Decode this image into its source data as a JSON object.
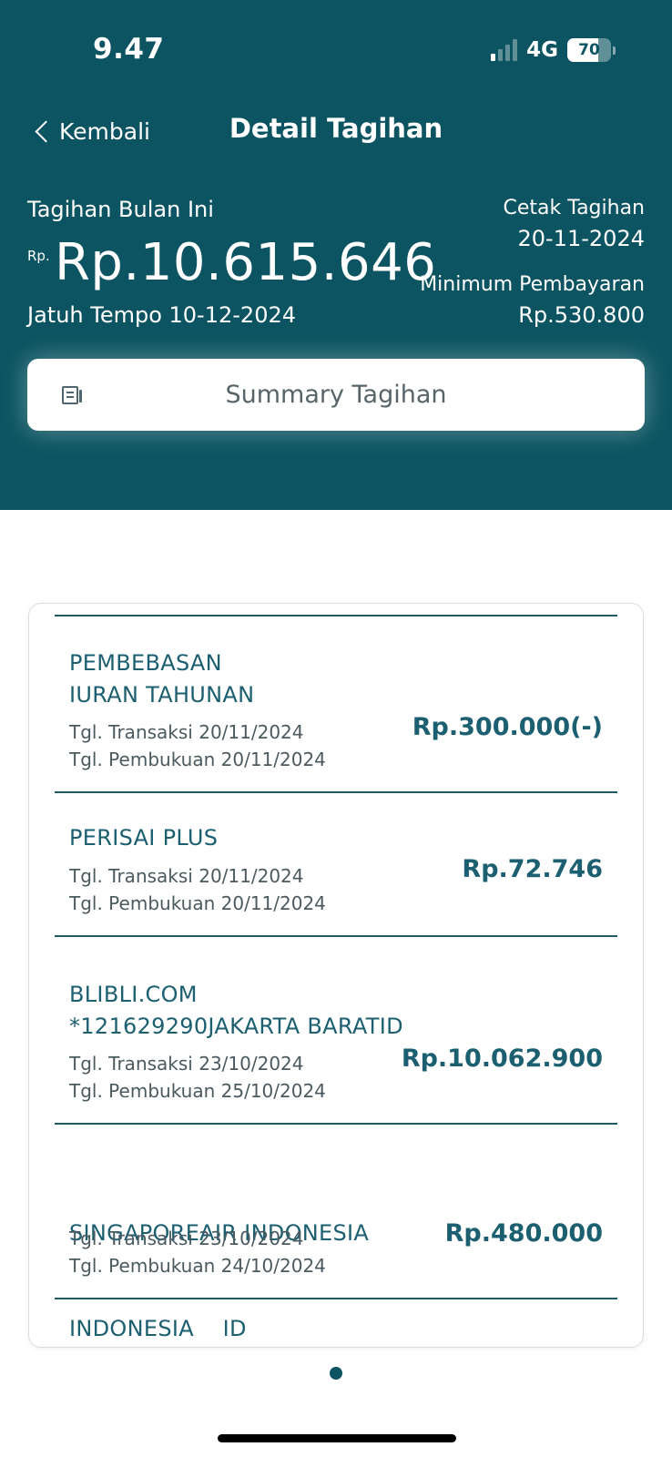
{
  "status_bar": {
    "time": "9.47",
    "network": "4G",
    "battery": "70",
    "battery_level": 0.7
  },
  "nav": {
    "back_label": "Kembali",
    "title": "Detail Tagihan"
  },
  "bill": {
    "label": "Tagihan Bulan Ini",
    "currency_prefix": "Rp.",
    "amount": "Rp.10.615.646",
    "due": "Jatuh Tempo 10-12-2024",
    "print_label": "Cetak Tagihan",
    "print_date": "20-11-2024",
    "min_label": "Minimum Pembayaran",
    "min_value": "Rp.530.800"
  },
  "summary_button": {
    "label": "Summary Tagihan",
    "icon": "document-list-icon"
  },
  "transactions": [
    {
      "name_lines": [
        "PEMBEBASAN",
        "IURAN TAHUNAN"
      ],
      "trx_label": "Tgl. Transaksi",
      "trx_date": "20/11/2024",
      "book_label": "Tgl. Pembukuan",
      "book_date": "20/11/2024",
      "amount": "Rp.300.000(-)"
    },
    {
      "name_lines": [
        "PERISAI PLUS"
      ],
      "trx_label": "Tgl. Transaksi",
      "trx_date": "20/11/2024",
      "book_label": "Tgl. Pembukuan",
      "book_date": "20/11/2024",
      "amount": "Rp.72.746"
    },
    {
      "name_lines": [
        "BLIBLI.COM",
        "*121629290JAKARTA BARATID"
      ],
      "trx_label": "Tgl. Transaksi",
      "trx_date": "23/10/2024",
      "book_label": "Tgl. Pembukuan",
      "book_date": "25/10/2024",
      "amount": "Rp.10.062.900"
    },
    {
      "name_lines": [
        "SINGAPOREAIR INDONESIA",
        "INDONESIA    ID"
      ],
      "trx_label": "Tgl. Transaksi",
      "trx_date": "23/10/2024",
      "book_label": "Tgl. Pembukuan",
      "book_date": "24/10/2024",
      "amount": "Rp.480.000"
    }
  ],
  "colors": {
    "header_bg": "#0c5461",
    "accent_text": "#1b5f70"
  }
}
